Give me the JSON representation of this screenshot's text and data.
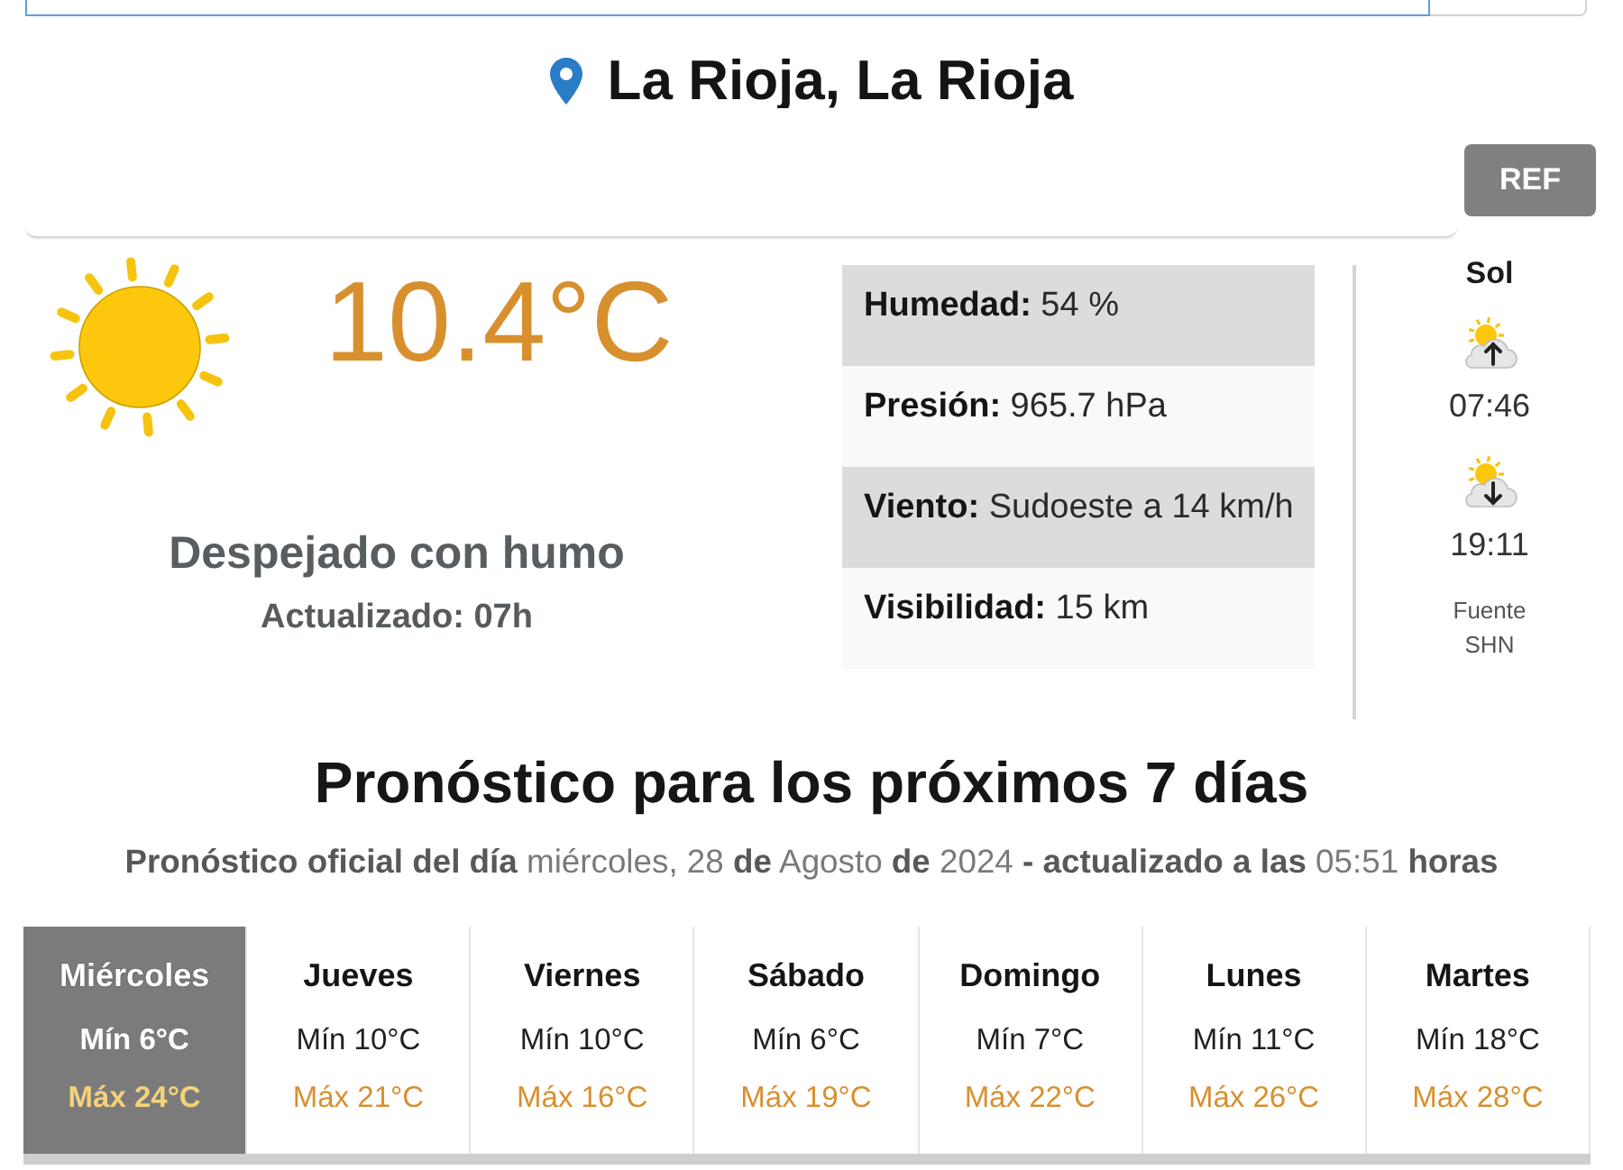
{
  "location": {
    "name": "La Rioja, La Rioja"
  },
  "refresh_button": {
    "label": "REF"
  },
  "current": {
    "temperature": "10.4°C",
    "condition": "Despejado con humo",
    "updated": "Actualizado: 07h"
  },
  "details": [
    {
      "text": "**Humedad:** 54 %"
    },
    {
      "text": "**Presión:** 965.7 hPa"
    },
    {
      "text": "**Viento:** Sudoeste a 14 km/h"
    },
    {
      "text": "**Visibilidad:** 15 km"
    }
  ],
  "sun": {
    "title": "Sol",
    "sunrise": "07:46",
    "sunset": "19:11",
    "source_label": "Fuente",
    "source": "SHN"
  },
  "forecast": {
    "title": "Pronóstico para los próximos 7 días",
    "subtitle": "**Pronóstico oficial del día** miércoles, 28 **de** Agosto **de** 2024 **- actualizado a las** 05:51 **horas**",
    "days": [
      {
        "day": "Miércoles",
        "min": "Mín 6°C",
        "max": "Máx 24°C",
        "selected": true
      },
      {
        "day": "Jueves",
        "min": "Mín 10°C",
        "max": "Máx 21°C",
        "selected": false
      },
      {
        "day": "Viernes",
        "min": "Mín 10°C",
        "max": "Máx 16°C",
        "selected": false
      },
      {
        "day": "Sábado",
        "min": "Mín 6°C",
        "max": "Máx 19°C",
        "selected": false
      },
      {
        "day": "Domingo",
        "min": "Mín 7°C",
        "max": "Máx 22°C",
        "selected": false
      },
      {
        "day": "Lunes",
        "min": "Mín 11°C",
        "max": "Máx 26°C",
        "selected": false
      },
      {
        "day": "Martes",
        "min": "Mín 18°C",
        "max": "Máx 28°C",
        "selected": false
      }
    ]
  }
}
